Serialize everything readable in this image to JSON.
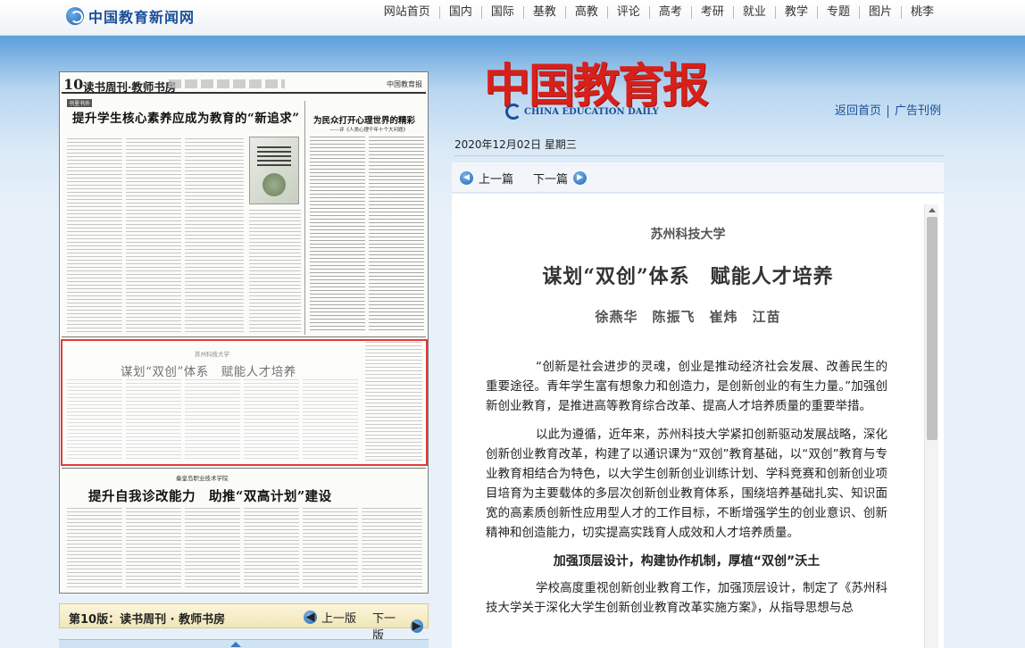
{
  "site": {
    "logo_text": "中国教育新闻网",
    "nav": [
      "网站首页",
      "国内",
      "国际",
      "基教",
      "高教",
      "评论",
      "高考",
      "考研",
      "就业",
      "教学",
      "专题",
      "图片",
      "桃李"
    ]
  },
  "masthead": {
    "title": "中国教育报",
    "subtitle_en": "CHINA EDUCATION DAILY",
    "links": [
      "返回首页",
      "广告刊例"
    ],
    "date": "2020年12月02日  星期三"
  },
  "paper_page": {
    "page_no": "10",
    "page_name": "读书周刊·教师书房",
    "masthead_small": "中国教育报",
    "article1_kicker": "书里书外",
    "article1_title": "提升学生核心素养应成为教育的“新追求”",
    "article2_title": "为民众打开心理世界的精彩",
    "article2_subtitle": "——评《人类心理千年十个大问题》",
    "article3_kicker": "苏州科技大学",
    "article3_title": "谋划“双创”体系　赋能人才培养",
    "article4_kicker": "秦皇岛职业技术学院",
    "article4_title": "提升自我诊改能力　助推“双高计划”建设",
    "footer_label": "第10版：读书周刊 · 教师书房",
    "prev_label": "上一版",
    "next_label": "下一版"
  },
  "article_nav": {
    "prev_label": "上一篇",
    "next_label": "下一篇"
  },
  "article": {
    "school": "苏州科技大学",
    "title": "谋划“双创”体系　赋能人才培养",
    "authors": "徐燕华　陈振飞　崔炜　江苗",
    "paragraphs": [
      "“创新是社会进步的灵魂，创业是推动经济社会发展、改善民生的重要途径。青年学生富有想象力和创造力，是创新创业的有生力量。”加强创新创业教育，是推进高等教育综合改革、提高人才培养质量的重要举措。",
      "以此为遵循，近年来，苏州科技大学紧扣创新驱动发展战略，深化创新创业教育改革，构建了以通识课为“双创”教育基础，以“双创”教育与专业教育相结合为特色，以大学生创新创业训练计划、学科竞赛和创新创业项目培育为主要载体的多层次创新创业教育体系，围绕培养基础扎实、知识面宽的高素质创新性应用型人才的工作目标，不断增强学生的创业意识、创新精神和创造能力，切实提高实践育人成效和人才培养质量。"
    ],
    "section_heading": "加强顶层设计，构建协作机制，厚植“双创”沃土",
    "paragraph3": "学校高度重视创新创业教育工作，加强顶层设计，制定了《苏州科技大学关于深化大学生创新创业教育改革实施方案》，从指导思想与总"
  },
  "colors": {
    "brand_blue": "#1a4f9a",
    "mast_red": "#d8201a",
    "highlight_red": "#e23a3a"
  },
  "icons": [
    "logo-globe-icon",
    "arrow-left-icon",
    "arrow-right-icon",
    "scroll-up-icon"
  ]
}
